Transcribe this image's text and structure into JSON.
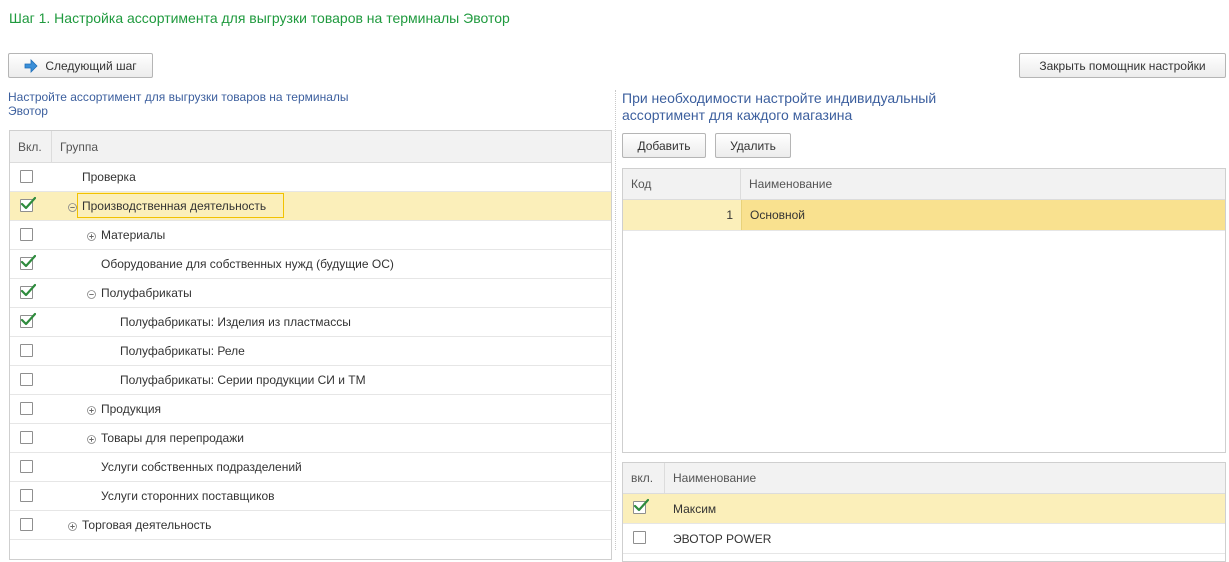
{
  "header": {
    "title": "Шаг 1. Настройка ассортимента для выгрузки товаров на терминалы Эвотор"
  },
  "toolbar": {
    "next_step": "Следующий шаг",
    "close_wizard": "Закрыть помощник настройки"
  },
  "left": {
    "hint": "Настройте ассортимент для выгрузки товаров на терминалы Эвотор",
    "columns": {
      "vkl": "Вкл.",
      "group": "Группа"
    },
    "rows": [
      {
        "label": "Проверка",
        "checked": false,
        "expander": ""
      },
      {
        "label": "Производственная деятельность",
        "checked": true,
        "expander": "minus",
        "selected": true
      },
      {
        "label": "Материалы",
        "checked": false,
        "expander": "plus"
      },
      {
        "label": "Оборудование для собственных нужд (будущие ОС)",
        "checked": true,
        "expander": ""
      },
      {
        "label": "Полуфабрикаты",
        "checked": true,
        "expander": "minus"
      },
      {
        "label": "Полуфабрикаты: Изделия из пластмассы",
        "checked": true,
        "expander": ""
      },
      {
        "label": "Полуфабрикаты: Реле",
        "checked": false,
        "expander": ""
      },
      {
        "label": "Полуфабрикаты: Серии продукции СИ и ТМ",
        "checked": false,
        "expander": ""
      },
      {
        "label": "Продукция",
        "checked": false,
        "expander": "plus"
      },
      {
        "label": "Товары для перепродажи",
        "checked": false,
        "expander": "plus"
      },
      {
        "label": "Услуги собственных подразделений",
        "checked": false,
        "expander": ""
      },
      {
        "label": "Услуги сторонних поставщиков",
        "checked": false,
        "expander": ""
      },
      {
        "label": "Торговая деятельность",
        "checked": false,
        "expander": "plus"
      }
    ]
  },
  "right": {
    "hint": "При необходимости настройте индивидуальный ассортимент для каждого магазина",
    "add_button": "Добавить",
    "delete_button": "Удалить",
    "stores_table": {
      "columns": {
        "code": "Код",
        "name": "Наименование"
      },
      "rows": [
        {
          "code": "1",
          "name": "Основной"
        }
      ]
    },
    "terminals_table": {
      "columns": {
        "vkl": "вкл.",
        "name": "Наименование"
      },
      "rows": [
        {
          "name": "Максим",
          "checked": true
        },
        {
          "name": "ЭВОТОР POWER",
          "checked": false
        }
      ]
    }
  },
  "colors": {
    "title_green": "#1f9a3e",
    "hint_blue": "#3c5f9e",
    "selection_yellow": "#fbefba",
    "check_green": "#2e8b3d"
  }
}
